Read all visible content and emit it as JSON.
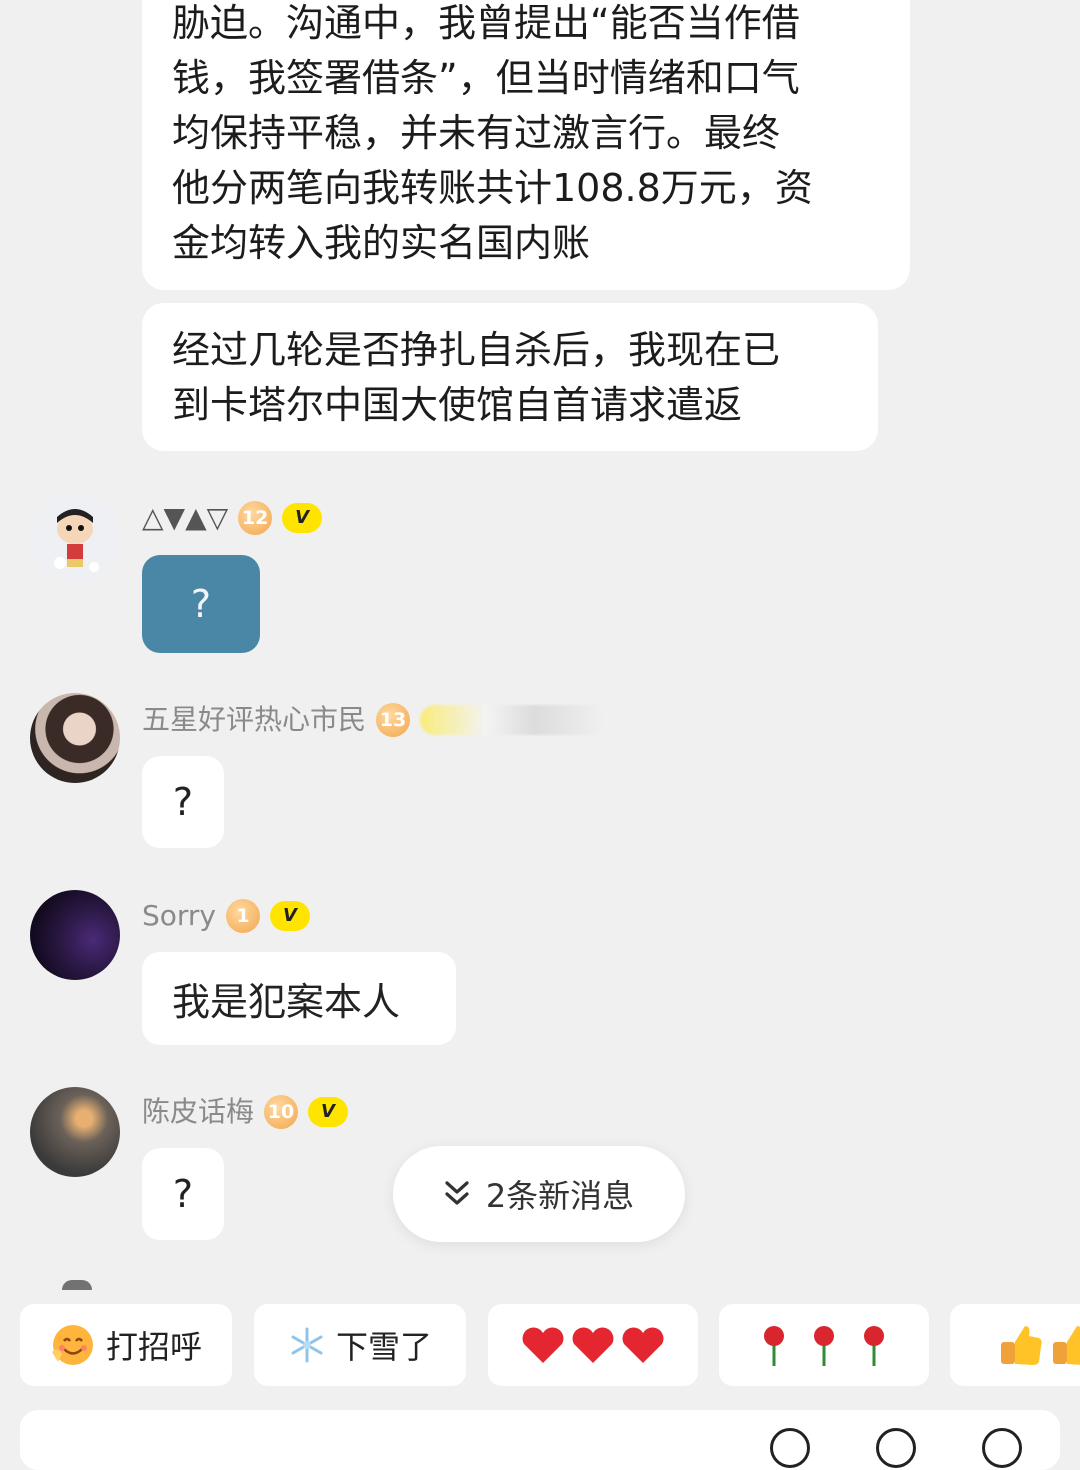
{
  "messages": {
    "bubble1": [
      "胁迫。沟通中，我曾提出“能否当作借",
      "钱，我签署借条”，但当时情绪和口气",
      "均保持平稳，并未有过激言行。最终",
      "他分两笔向我转账共计108.8万元，资",
      "金均转入我的实名国内账"
    ],
    "bubble2": [
      "经过几轮是否挣扎自杀后，我现在已",
      "到卡塔尔中国大使馆自首请求遣返"
    ]
  },
  "users": [
    {
      "name": "△▼▲▽",
      "level": "12",
      "badge": "V",
      "message": "?"
    },
    {
      "name": "五星好评热心市民",
      "level": "13",
      "message": "?"
    },
    {
      "name": "Sorry",
      "level": "1",
      "badge": "V",
      "message": "我是犯案本人"
    },
    {
      "name": "陈皮话梅",
      "level": "10",
      "badge": "V",
      "message": "?"
    }
  ],
  "new_messages": "2条新消息",
  "quick_replies": [
    {
      "label": "打招呼",
      "icon": "smile-emoji"
    },
    {
      "label": "下雪了",
      "icon": "snowflake-emoji"
    },
    {
      "label": "❤️❤️❤️",
      "icon": "hearts-emoji"
    },
    {
      "label": "🌹 🌹 🌹",
      "icon": "rose-emoji"
    },
    {
      "label": "👍👍",
      "icon": "thumbs-up-emoji"
    }
  ],
  "colors": {
    "background": "#f0f0f0",
    "blue_bubble": "#4a87a6",
    "vip_badge": "#ffe400",
    "level_badge": "#f2a64d"
  }
}
